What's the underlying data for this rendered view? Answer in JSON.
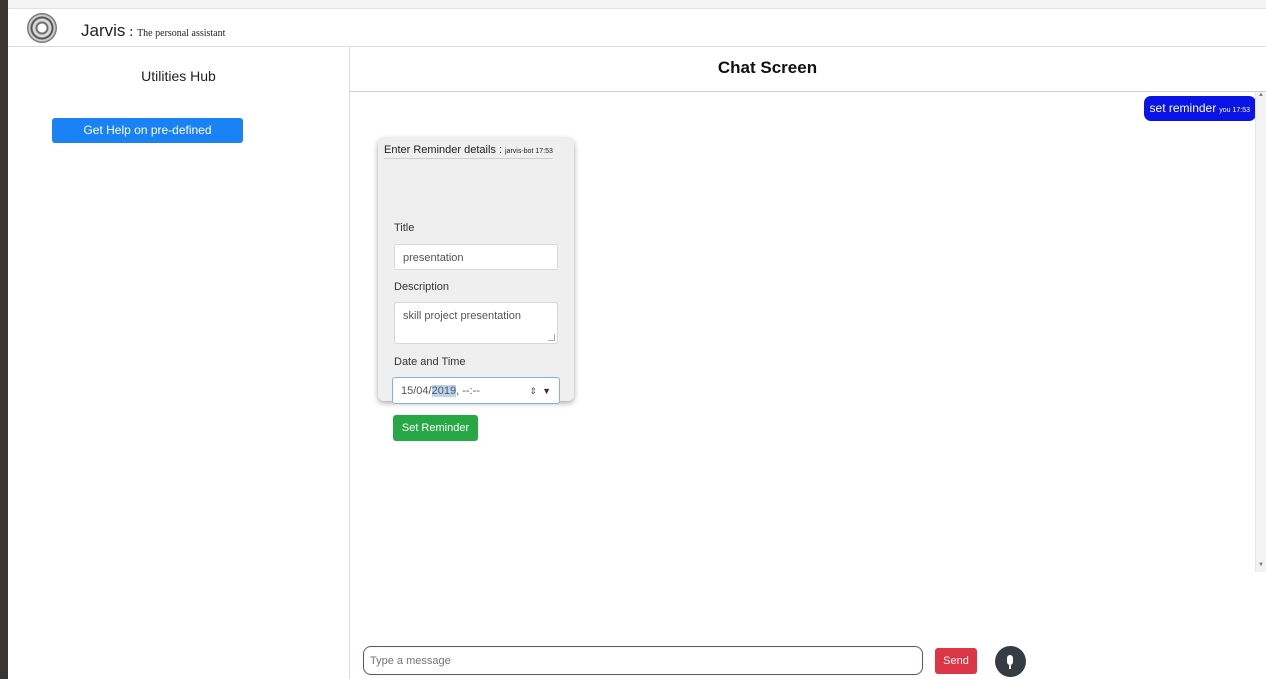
{
  "app": {
    "name": "Jarvis",
    "separator": " : ",
    "tagline": "The personal assistant"
  },
  "sidebar": {
    "title": "Utilities Hub",
    "help_button": "Get Help on pre-defined Statements"
  },
  "chat": {
    "title": "Chat Screen",
    "messages": [
      {
        "sender": "you",
        "text": "set reminder",
        "time": "17:53"
      },
      {
        "sender": "jarvis-bot",
        "text": "Enter Reminder details :",
        "time": "17:53"
      }
    ]
  },
  "reminder_form": {
    "title_label": "Title",
    "title_value": "presentation",
    "description_label": "Description",
    "description_value": "skill project presentation",
    "datetime_label": "Date and Time",
    "datetime_prefix": "15/04/",
    "datetime_year": "2019",
    "datetime_suffix": ", --:--",
    "submit_label": "Set Reminder"
  },
  "composer": {
    "placeholder": "Type a message",
    "send_label": "Send"
  },
  "icons": [
    "logo-icon",
    "mic-icon",
    "spinner-icon",
    "dropdown-icon"
  ],
  "colors": {
    "help_button": "#1a82f5",
    "user_bubble": "#0a14e6",
    "set_reminder": "#28a745",
    "send": "#dc3545",
    "mic": "#353c44"
  }
}
